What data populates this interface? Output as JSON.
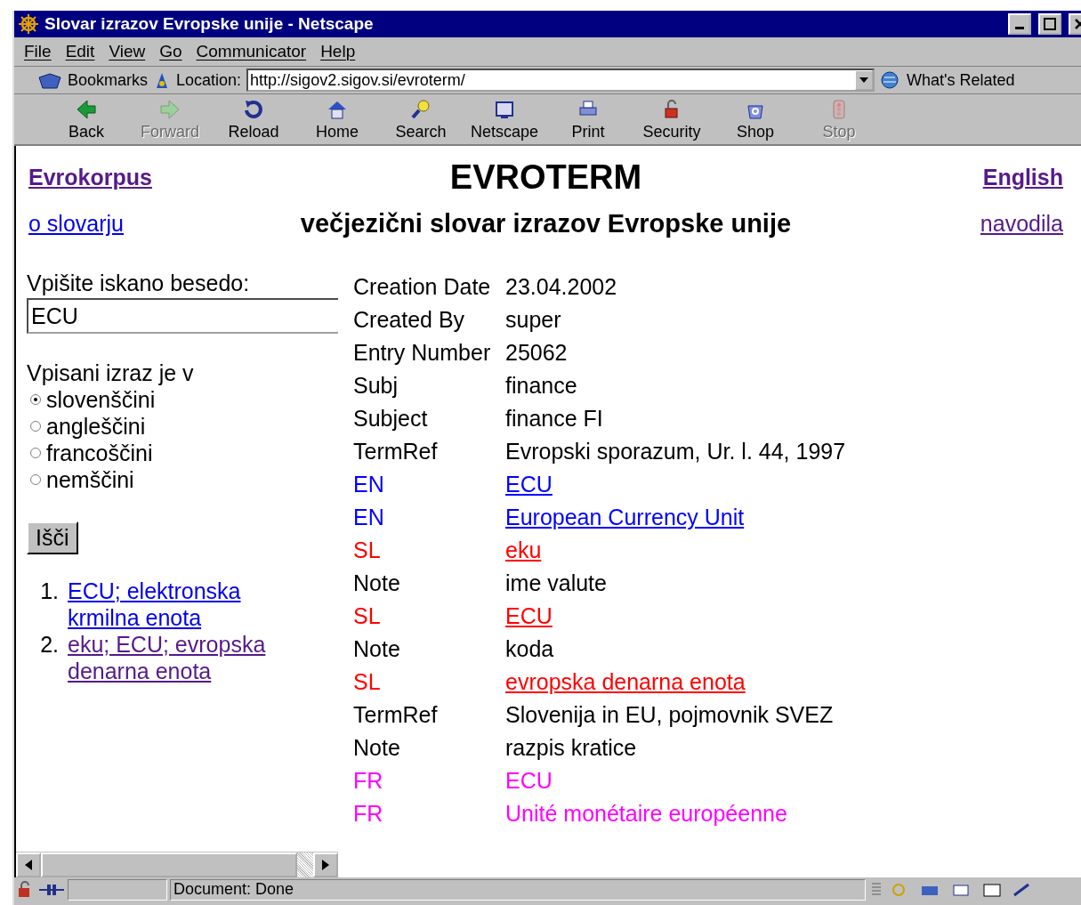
{
  "window": {
    "title": "Slovar izrazov Evropske unije - Netscape"
  },
  "menu": [
    "File",
    "Edit",
    "View",
    "Go",
    "Communicator",
    "Help"
  ],
  "location_bar": {
    "bookmarks": "Bookmarks",
    "label": "Location:",
    "url": "http://sigov2.sigov.si/evroterm/",
    "related": "What's Related"
  },
  "toolbar": [
    {
      "label": "Back",
      "disabled": false
    },
    {
      "label": "Forward",
      "disabled": true
    },
    {
      "label": "Reload",
      "disabled": false
    },
    {
      "label": "Home",
      "disabled": false
    },
    {
      "label": "Search",
      "disabled": false
    },
    {
      "label": "Netscape",
      "disabled": false
    },
    {
      "label": "Print",
      "disabled": false
    },
    {
      "label": "Security",
      "disabled": false
    },
    {
      "label": "Shop",
      "disabled": false
    },
    {
      "label": "Stop",
      "disabled": true
    }
  ],
  "header": {
    "left_top": {
      "text": "Evrokorpus",
      "visited": true
    },
    "title": "EVROTERM",
    "right_top": {
      "text": "English",
      "visited": true
    },
    "left_bottom": {
      "text": "o slovarju",
      "visited": false
    },
    "subtitle": "večjezični slovar izrazov Evropske unije",
    "right_bottom": {
      "text": "navodila",
      "visited": true
    }
  },
  "search_form": {
    "label": "Vpišite iskano besedo:",
    "value": "ECU",
    "language_label": "Vpisani izraz je v",
    "languages": [
      {
        "label": "slovenščini",
        "selected": true
      },
      {
        "label": "angleščini",
        "selected": false
      },
      {
        "label": "francoščini",
        "selected": false
      },
      {
        "label": "nemščini",
        "selected": false
      }
    ],
    "button": "Išči"
  },
  "results": [
    {
      "number": "1.",
      "text": "ECU; elektronska krmilna enota",
      "visited": false
    },
    {
      "number": "2.",
      "text": "eku; ECU; evropska denarna enota",
      "visited": true
    }
  ],
  "entry": [
    {
      "label": "Creation Date",
      "value": "23.04.2002",
      "color": "#000000",
      "link": false
    },
    {
      "label": "Created By",
      "value": "super",
      "color": "#000000",
      "link": false
    },
    {
      "label": "Entry Number",
      "value": "25062",
      "color": "#000000",
      "link": false
    },
    {
      "label": "Subj",
      "value": "finance",
      "color": "#000000",
      "link": false
    },
    {
      "label": "Subject",
      "value": "finance FI",
      "color": "#000000",
      "link": false
    },
    {
      "label": "TermRef",
      "value": "Evropski sporazum, Ur. l. 44, 1997",
      "color": "#000000",
      "link": false
    },
    {
      "label": "EN",
      "value": "ECU",
      "color": "#0000ff",
      "link": true
    },
    {
      "label": "EN",
      "value": "European Currency Unit",
      "color": "#0000ff",
      "link": true
    },
    {
      "label": "SL",
      "value": "eku",
      "color": "#ff0000",
      "link": true
    },
    {
      "label": "Note",
      "value": "ime valute",
      "color": "#000000",
      "link": false
    },
    {
      "label": "SL",
      "value": "ECU",
      "color": "#ff0000",
      "link": true
    },
    {
      "label": "Note",
      "value": "koda",
      "color": "#000000",
      "link": false
    },
    {
      "label": "SL",
      "value": "evropska denarna enota",
      "color": "#ff0000",
      "link": true
    },
    {
      "label": "TermRef",
      "value": "Slovenija in EU, pojmovnik SVEZ",
      "color": "#000000",
      "link": false
    },
    {
      "label": "Note",
      "value": "razpis kratice",
      "color": "#000000",
      "link": false
    },
    {
      "label": "FR",
      "value": "ECU",
      "color": "#ff00ff",
      "link": false
    },
    {
      "label": "FR",
      "value": "Unité monétaire européenne",
      "color": "#ff00ff",
      "link": false
    }
  ],
  "status_bar": {
    "text": "Document: Done"
  }
}
